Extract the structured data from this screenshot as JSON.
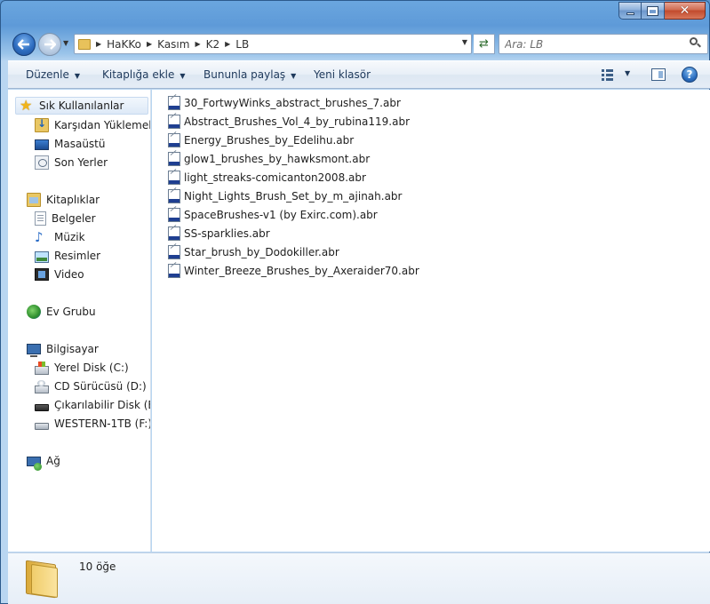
{
  "window": {
    "minimize_glyph": "–",
    "maximize_glyph": "□",
    "close_glyph": "✕"
  },
  "address": {
    "crumbs": [
      "HaKKo",
      "Kasım",
      "K2",
      "LB"
    ]
  },
  "search": {
    "placeholder": "Ara: LB"
  },
  "toolbar": {
    "organize_label": "Düzenle",
    "include_library_label": "Kitaplığa ekle",
    "share_with_label": "Bununla paylaş",
    "new_folder_label": "Yeni klasör",
    "help_glyph": "?"
  },
  "sidebar": {
    "favorites": {
      "label": "Sık Kullanılanlar",
      "items": [
        {
          "label": "Karşıdan Yüklemeler",
          "icon": "downloads-icon"
        },
        {
          "label": "Masaüstü",
          "icon": "desktop-icon"
        },
        {
          "label": "Son Yerler",
          "icon": "recent-places-icon"
        }
      ]
    },
    "libraries": {
      "label": "Kitaplıklar",
      "items": [
        {
          "label": "Belgeler",
          "icon": "documents-icon"
        },
        {
          "label": "Müzik",
          "icon": "music-icon"
        },
        {
          "label": "Resimler",
          "icon": "pictures-icon"
        },
        {
          "label": "Video",
          "icon": "video-icon"
        }
      ]
    },
    "homegroup": {
      "label": "Ev Grubu"
    },
    "computer": {
      "label": "Bilgisayar",
      "items": [
        {
          "label": "Yerel Disk (C:)",
          "icon": "local-disk-icon"
        },
        {
          "label": "CD Sürücüsü (D:)",
          "icon": "cd-drive-icon"
        },
        {
          "label": "Çıkarılabilir Disk (E:)",
          "icon": "removable-disk-icon"
        },
        {
          "label": "WESTERN-1TB (F:)",
          "icon": "hard-drive-icon"
        }
      ]
    },
    "network": {
      "label": "Ağ"
    }
  },
  "files": [
    "30_FortwyWinks_abstract_brushes_7.abr",
    "Abstract_Brushes_Vol_4_by_rubina119.abr",
    "Energy_Brushes_by_Edelihu.abr",
    "glow1_brushes_by_hawksmont.abr",
    "light_streaks-comicanton2008.abr",
    "Night_Lights_Brush_Set_by_m_ajinah.abr",
    "SpaceBrushes-v1 (by Exirc.com).abr",
    "SS-sparklies.abr",
    "Star_brush_by_Dodokiller.abr",
    "Winter_Breeze_Brushes_by_Axeraider70.abr"
  ],
  "details": {
    "item_count": "10 öğe"
  }
}
